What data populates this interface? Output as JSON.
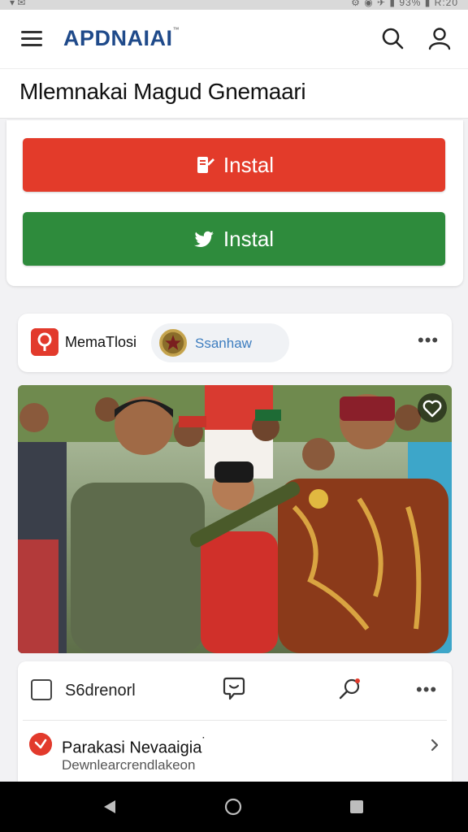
{
  "status_bar": {
    "left": "▾ ✉",
    "right": "⚙ ◉ ✈ ▮ 93% ▮ R:20"
  },
  "app_bar": {
    "logo_text": "APDNAIAI",
    "logo_mark": "™"
  },
  "page": {
    "title": "Mlemnakai Magud Gnemaari"
  },
  "install": {
    "primary_label": "Instal",
    "secondary_label": "Instal",
    "primary_color": "#e33b2a",
    "secondary_color": "#2e8b3c"
  },
  "source": {
    "name": "MemaTlosi",
    "chip_label": "Ssanhaw",
    "more": "•••"
  },
  "actions": {
    "save_label": "S6drenorl",
    "more": "•••"
  },
  "news": {
    "title": "Parakasi Nevaaigia",
    "title_mark": "˙",
    "subtitle": "Dewnlearcrendlakeon"
  }
}
